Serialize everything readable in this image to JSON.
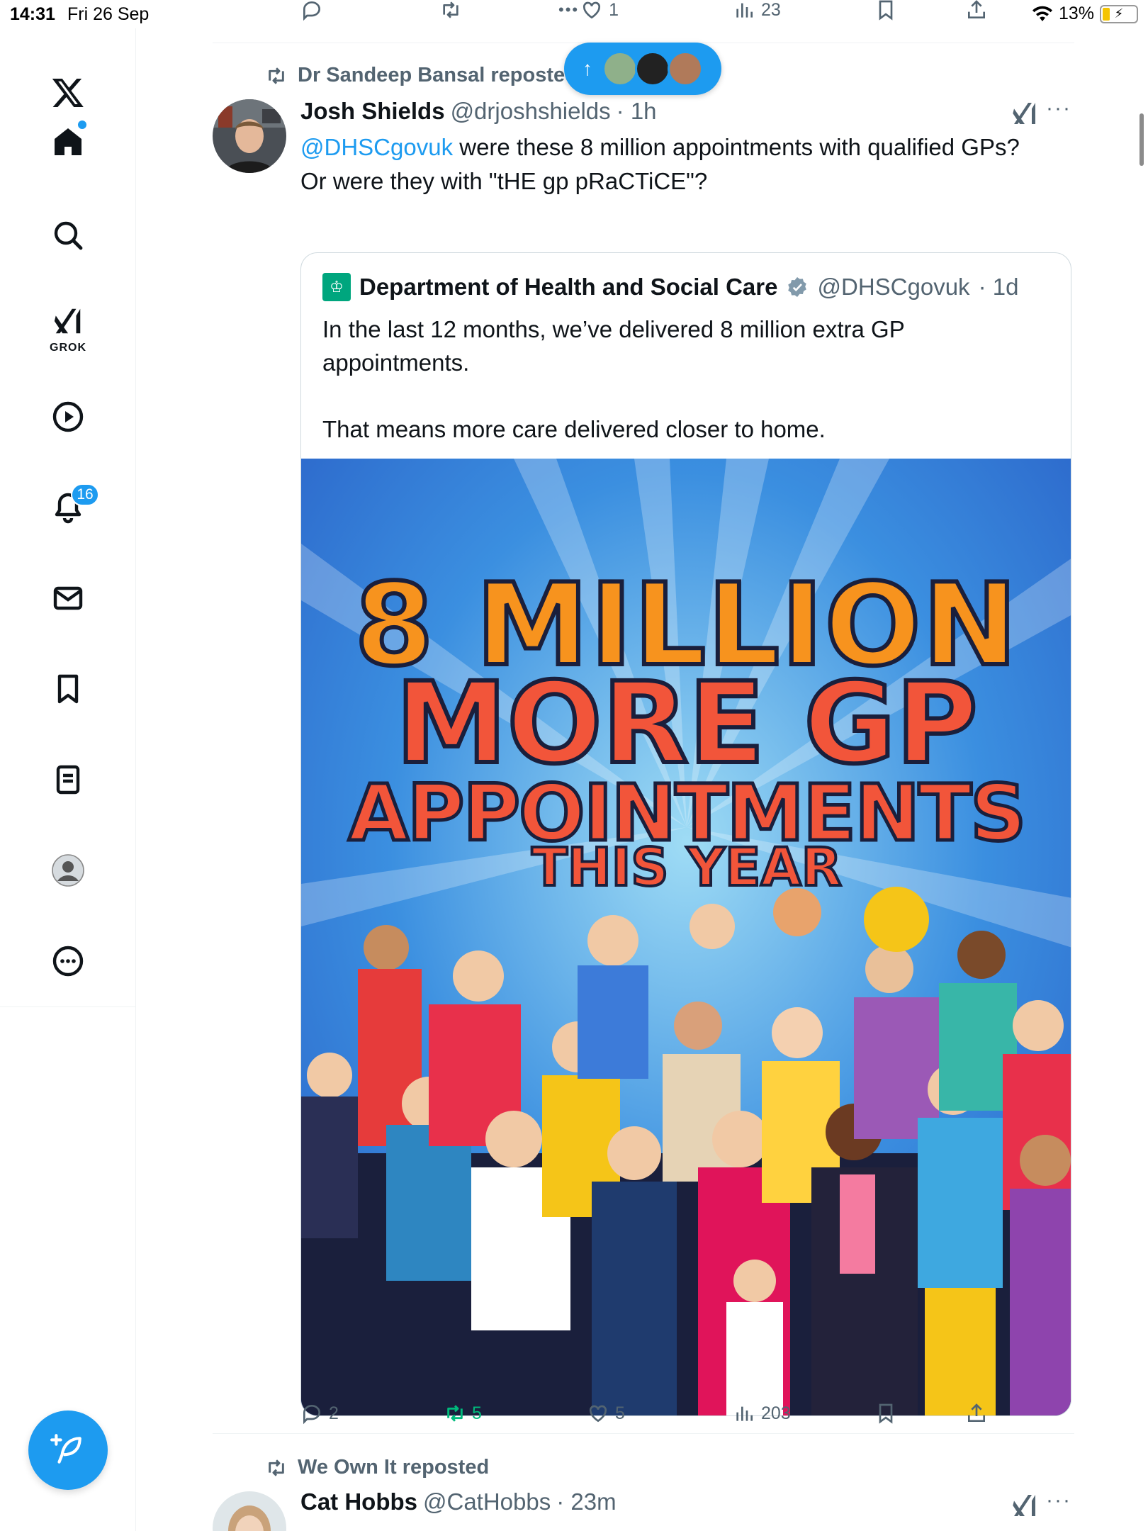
{
  "status_bar": {
    "time": "14:31",
    "date": "Fri 26 Sep",
    "battery_percent": "13%"
  },
  "sidebar": {
    "items": [
      {
        "name": "home",
        "label": "Home"
      },
      {
        "name": "search",
        "label": "Explore"
      },
      {
        "name": "grok",
        "label": "GROK"
      },
      {
        "name": "video",
        "label": "Video"
      },
      {
        "name": "notifications",
        "label": "Notifications",
        "badge": "16"
      },
      {
        "name": "messages",
        "label": "Messages"
      },
      {
        "name": "bookmarks",
        "label": "Bookmarks"
      },
      {
        "name": "lists",
        "label": "Lists"
      },
      {
        "name": "profile",
        "label": "Profile"
      },
      {
        "name": "more",
        "label": "More"
      }
    ],
    "compose_icon": "feather-plus-icon"
  },
  "feed": {
    "previous_tweet_actions": {
      "likes": "1",
      "views": "23"
    },
    "tweet1": {
      "repost_label": "Dr Sandeep Bansal reposted",
      "name": "Josh Shields",
      "handle": "@drjoshshields",
      "time": "· 1h",
      "mention": "@DHSCgovuk",
      "text_after_mention": " were these 8 million appointments with qualified GPs? Or were they with \"tHE gp pRaCTiCE\"?",
      "quote": {
        "name": "Department of Health and Social Care",
        "handle": "@DHSCgovuk",
        "time": "· 1d",
        "lines": [
          "In the last 12 months, we’ve delivered 8 million extra GP appointments.",
          "",
          "That means more care delivered closer to home."
        ],
        "poster": {
          "line1": "8 MILLION",
          "line2": "MORE GP",
          "line3": "APPOINTMENTS",
          "line4": "THIS YEAR"
        }
      },
      "actions": {
        "replies": "2",
        "reposts": "5",
        "likes": "5",
        "views": "203"
      }
    },
    "tweet2": {
      "repost_label": "We Own It reposted",
      "name": "Cat Hobbs",
      "handle": "@CatHobbs",
      "time": "· 23m"
    }
  },
  "colors": {
    "accent": "#1d9bf0",
    "repost_green": "#00ba7c",
    "muted": "#536471"
  }
}
